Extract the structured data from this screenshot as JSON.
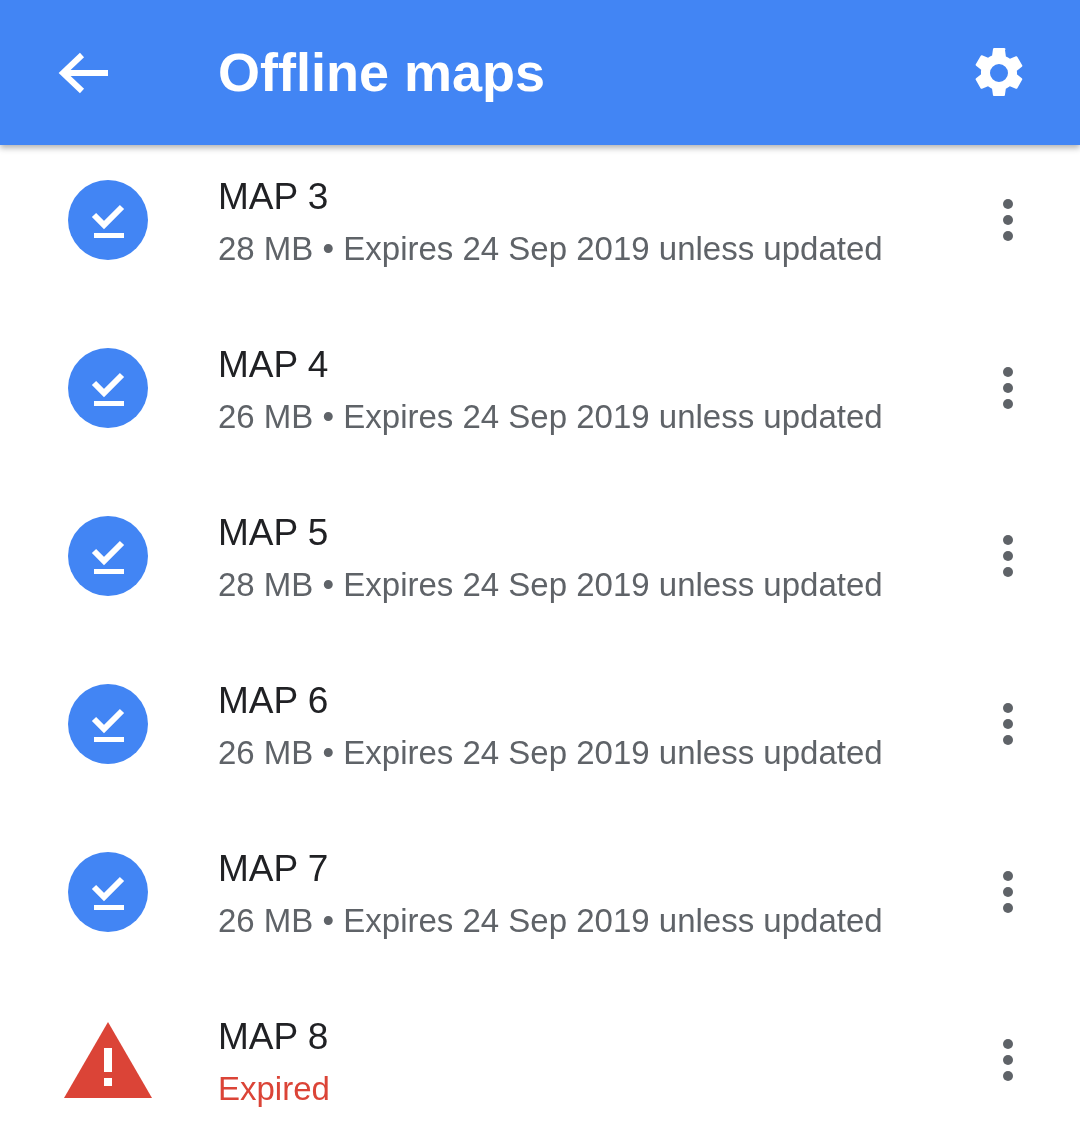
{
  "app_bar": {
    "title": "Offline maps"
  },
  "maps": [
    {
      "name": "MAP 3",
      "kind": "downloaded",
      "detail": "28 MB • Expires 24 Sep 2019 unless updated"
    },
    {
      "name": "MAP 4",
      "kind": "downloaded",
      "detail": "26 MB • Expires 24 Sep 2019 unless updated"
    },
    {
      "name": "MAP 5",
      "kind": "downloaded",
      "detail": "28 MB • Expires 24 Sep 2019 unless updated"
    },
    {
      "name": "MAP 6",
      "kind": "downloaded",
      "detail": "26 MB • Expires 24 Sep 2019 unless updated"
    },
    {
      "name": "MAP 7",
      "kind": "downloaded",
      "detail": "26 MB • Expires 24 Sep 2019 unless updated"
    },
    {
      "name": "MAP 8",
      "kind": "expired",
      "detail": "Expired"
    }
  ]
}
